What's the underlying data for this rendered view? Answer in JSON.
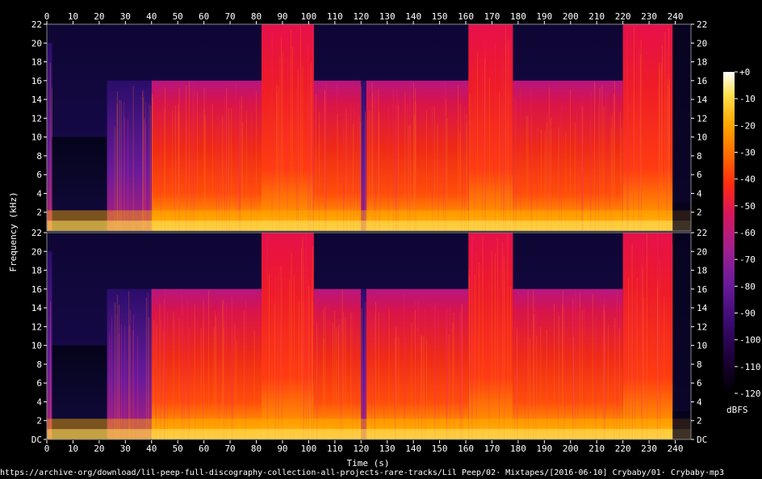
{
  "chart_data": {
    "type": "heatmap",
    "subtype": "spectrogram",
    "channels": 2,
    "xlabel": "Time (s)",
    "ylabel": "Frequency (kHz)",
    "colorbar_label": "dBFS",
    "xlim": [
      0,
      246
    ],
    "ylim_khz": [
      0,
      22
    ],
    "x_ticks": [
      0,
      10,
      20,
      30,
      40,
      50,
      60,
      70,
      80,
      90,
      100,
      110,
      120,
      130,
      140,
      150,
      160,
      170,
      180,
      190,
      200,
      210,
      220,
      230,
      240
    ],
    "y_ticks": [
      {
        "value": 0,
        "label": "DC"
      },
      {
        "value": 2,
        "label": "2"
      },
      {
        "value": 4,
        "label": "4"
      },
      {
        "value": 6,
        "label": "6"
      },
      {
        "value": 8,
        "label": "8"
      },
      {
        "value": 10,
        "label": "10"
      },
      {
        "value": 12,
        "label": "12"
      },
      {
        "value": 14,
        "label": "14"
      },
      {
        "value": 16,
        "label": "16"
      },
      {
        "value": 18,
        "label": "18"
      },
      {
        "value": 20,
        "label": "20"
      },
      {
        "value": 22,
        "label": "22"
      }
    ],
    "colorbar_ticks": [
      0,
      -10,
      -20,
      -30,
      -40,
      -50,
      -60,
      -70,
      -80,
      -90,
      -100,
      -110,
      -120
    ],
    "colorbar_labels": [
      "+0",
      "-10",
      "-20",
      "-30",
      "-40",
      "-50",
      "-60",
      "-70",
      "-80",
      "-90",
      "-100",
      "-110",
      "-120"
    ],
    "colorscale": [
      "#000000",
      "#1a0033",
      "#3a0a6e",
      "#6a1a9a",
      "#a0208f",
      "#d8165a",
      "#ff2a10",
      "#ff6a00",
      "#ffa800",
      "#ffe050",
      "#ffffff"
    ],
    "segments": [
      {
        "start": 0,
        "end": 2,
        "cutoff_khz": 20,
        "level_db": -70
      },
      {
        "start": 2,
        "end": 23,
        "cutoff_khz": 10,
        "level_db": -95
      },
      {
        "start": 23,
        "end": 40,
        "cutoff_khz": 16,
        "level_db": -72
      },
      {
        "start": 40,
        "end": 82,
        "cutoff_khz": 16,
        "level_db": -55
      },
      {
        "start": 82,
        "end": 102,
        "cutoff_khz": 22,
        "level_db": -52
      },
      {
        "start": 102,
        "end": 120,
        "cutoff_khz": 16,
        "level_db": -55
      },
      {
        "start": 120,
        "end": 122,
        "cutoff_khz": 16,
        "level_db": -80
      },
      {
        "start": 122,
        "end": 161,
        "cutoff_khz": 16,
        "level_db": -55
      },
      {
        "start": 161,
        "end": 178,
        "cutoff_khz": 22,
        "level_db": -52
      },
      {
        "start": 178,
        "end": 220,
        "cutoff_khz": 16,
        "level_db": -55
      },
      {
        "start": 220,
        "end": 239,
        "cutoff_khz": 22,
        "level_db": -52
      },
      {
        "start": 239,
        "end": 246,
        "cutoff_khz": 3,
        "level_db": -100
      }
    ]
  },
  "footer_path": "https://archive·org/download/lil-peep-full-discography-collection-all-projects-rare-tracks/Lil Peep/02· Mixtapes/[2016·06·10] Crybaby/01· Crybaby·mp3"
}
